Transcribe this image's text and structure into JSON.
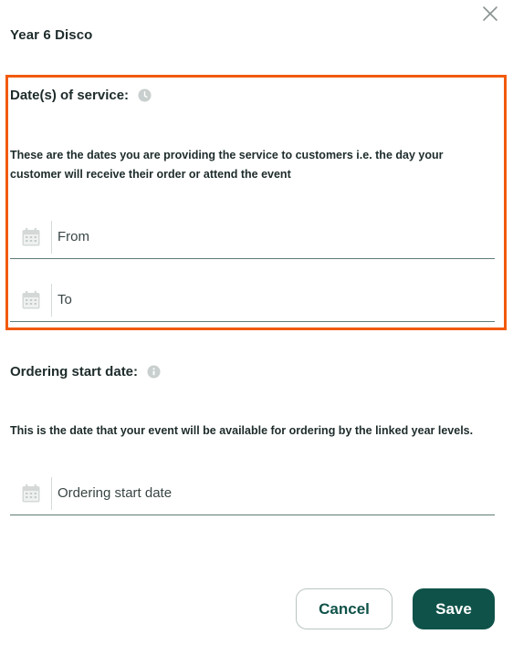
{
  "dialog": {
    "title": "Year 6 Disco",
    "close_icon": "close-icon"
  },
  "service_dates": {
    "label": "Date(s) of service:",
    "info_icon": "clock-icon",
    "help_text": "These are the dates you are providing the service to customers i.e. the day your customer will receive their order or attend the event",
    "from": {
      "placeholder": "From",
      "icon": "calendar-icon"
    },
    "to": {
      "placeholder": "To",
      "icon": "calendar-icon"
    },
    "highlight_color": "#f25a0c"
  },
  "ordering_start": {
    "label": "Ordering start date:",
    "info_icon": "info-icon",
    "help_text": "This is the date that your event will be available for ordering by the linked year levels.",
    "field": {
      "placeholder": "Ordering start date",
      "icon": "calendar-icon"
    }
  },
  "actions": {
    "cancel_label": "Cancel",
    "save_label": "Save"
  },
  "colors": {
    "primary": "#0f5249",
    "field_underline": "#5e7b78",
    "icon_grey": "#c9cfce"
  }
}
